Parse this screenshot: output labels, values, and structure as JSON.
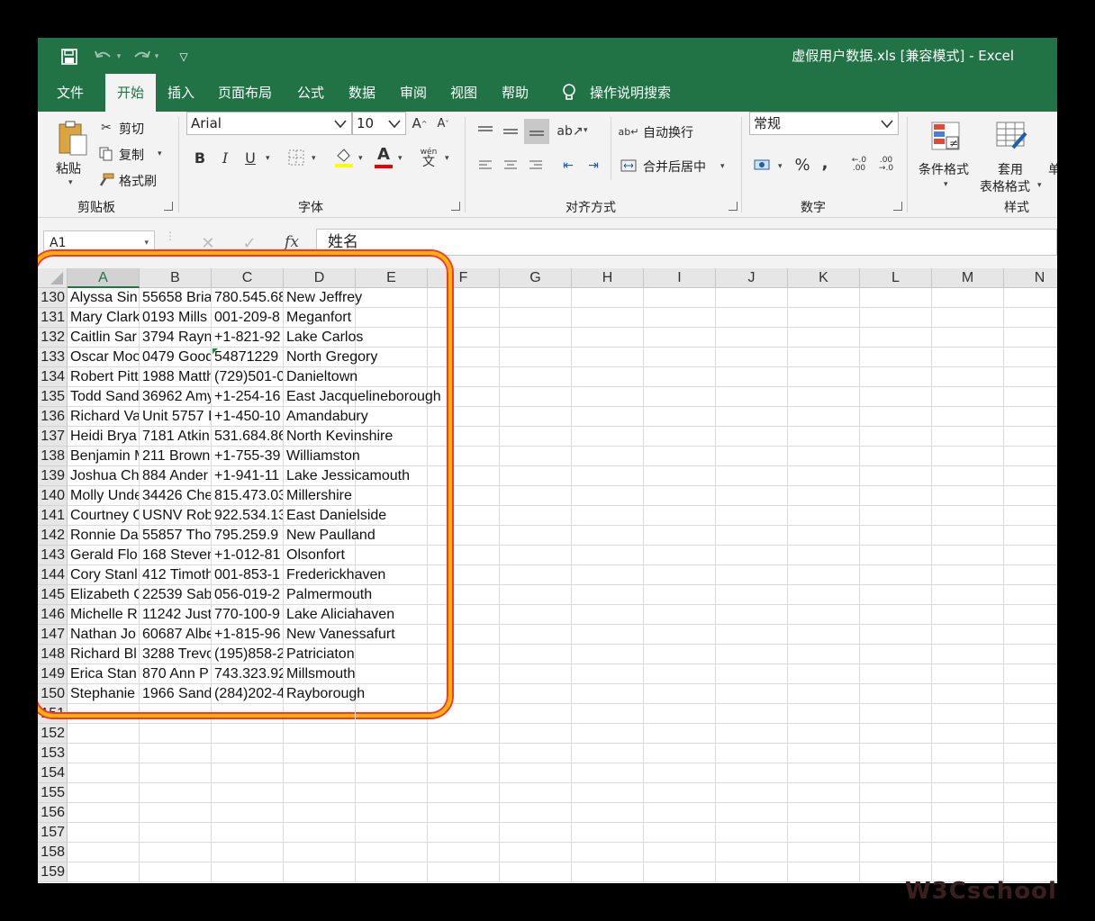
{
  "window": {
    "title": "虚假用户数据.xls  [兼容模式]  -  Excel",
    "colors": {
      "accent": "#217346",
      "ribbon": "#f3f3f3",
      "highlight": "#ffb400"
    }
  },
  "quick_access": {
    "icons": [
      "save-icon",
      "undo-icon",
      "redo-icon",
      "customize-icon"
    ]
  },
  "tabs": [
    {
      "label": "文件"
    },
    {
      "label": "开始",
      "active": true
    },
    {
      "label": "插入"
    },
    {
      "label": "页面布局"
    },
    {
      "label": "公式"
    },
    {
      "label": "数据"
    },
    {
      "label": "审阅"
    },
    {
      "label": "视图"
    },
    {
      "label": "帮助"
    },
    {
      "label": "操作说明搜索"
    }
  ],
  "ribbon": {
    "clipboard": {
      "label": "剪贴板",
      "paste": "粘贴",
      "cut": "剪切",
      "copy": "复制",
      "format_painter": "格式刷"
    },
    "font": {
      "label": "字体",
      "name": "Arial",
      "size": "10",
      "bold": "B",
      "italic": "I",
      "underline": "U",
      "font_color": "A",
      "phonetic": "wén"
    },
    "alignment": {
      "label": "对齐方式",
      "wrap": "自动换行",
      "merge": "合并后居中"
    },
    "number": {
      "label": "数字",
      "format": "常规",
      "percent": "%",
      "comma": ","
    },
    "styles": {
      "label": "样式",
      "conditional": "条件格式",
      "table_fmt_1": "套用",
      "table_fmt_2": "表格格式",
      "cell_styles": "单"
    }
  },
  "formula_bar": {
    "name_box": "A1",
    "fx": "fx",
    "value": "姓名"
  },
  "sheet": {
    "columns": [
      "A",
      "B",
      "C",
      "D",
      "E",
      "F",
      "G",
      "H",
      "I",
      "J",
      "K",
      "L",
      "M",
      "N"
    ],
    "rows": [
      {
        "n": "130",
        "a": "Alyssa Sin",
        "b": "55658 Bria",
        "c": "780.545.68",
        "d": "New Jeffrey"
      },
      {
        "n": "131",
        "a": "Mary Clark",
        "b": "0193 Mills",
        "c": "001-209-8",
        "d": "Meganfort"
      },
      {
        "n": "132",
        "a": "Caitlin Sar",
        "b": "3794 Rayn",
        "c": "+1-821-92",
        "d": "Lake Carlos"
      },
      {
        "n": "133",
        "a": "Oscar Moo",
        "b": "0479 Good",
        "c": "54871229",
        "d": "North Gregory"
      },
      {
        "n": "134",
        "a": "Robert Pitt",
        "b": "1988 Matth",
        "c": "(729)501-0",
        "d": "Danieltown"
      },
      {
        "n": "135",
        "a": "Todd Sand",
        "b": "36962 Amy",
        "c": "+1-254-16",
        "d": "East Jacquelineborough"
      },
      {
        "n": "136",
        "a": "Richard Va",
        "b": "Unit 5757 I",
        "c": "+1-450-10",
        "d": "Amandabury"
      },
      {
        "n": "137",
        "a": "Heidi Brya",
        "b": "7181 Atkin",
        "c": "531.684.86",
        "d": "North Kevinshire"
      },
      {
        "n": "138",
        "a": "Benjamin M",
        "b": "211 Brown",
        "c": "+1-755-39",
        "d": "Williamston"
      },
      {
        "n": "139",
        "a": "Joshua Ch",
        "b": "884 Ander",
        "c": "+1-941-11",
        "d": "Lake Jessicamouth"
      },
      {
        "n": "140",
        "a": "Molly Unde",
        "b": "34426 Che",
        "c": "815.473.03",
        "d": "Millershire"
      },
      {
        "n": "141",
        "a": "Courtney C",
        "b": "USNV Rob",
        "c": "922.534.13",
        "d": "East Danielside"
      },
      {
        "n": "142",
        "a": "Ronnie Da",
        "b": "55857 Tho",
        "c": "795.259.9",
        "d": "New Paulland"
      },
      {
        "n": "143",
        "a": "Gerald Flo",
        "b": "168 Steven",
        "c": "+1-012-81",
        "d": "Olsonfort"
      },
      {
        "n": "144",
        "a": "Cory Stanl",
        "b": "412 Timoth",
        "c": "001-853-1",
        "d": "Frederickhaven"
      },
      {
        "n": "145",
        "a": "Elizabeth C",
        "b": "22539 Sab",
        "c": "056-019-2",
        "d": "Palmermouth"
      },
      {
        "n": "146",
        "a": "Michelle R",
        "b": "11242 Just",
        "c": "770-100-9",
        "d": "Lake Aliciahaven"
      },
      {
        "n": "147",
        "a": "Nathan Jo",
        "b": "60687 Albe",
        "c": "+1-815-96",
        "d": "New Vanessafurt"
      },
      {
        "n": "148",
        "a": "Richard Bl",
        "b": "3288 Trevo",
        "c": "(195)858-2",
        "d": "Patriciaton"
      },
      {
        "n": "149",
        "a": "Erica Stan",
        "b": "870 Ann P",
        "c": "743.323.92",
        "d": "Millsmouth"
      },
      {
        "n": "150",
        "a": "Stephanie",
        "b": "1966 Sand",
        "c": "(284)202-4",
        "d": "Rayborough"
      },
      {
        "n": "151",
        "a": "",
        "b": "",
        "c": "",
        "d": ""
      },
      {
        "n": "152",
        "a": "",
        "b": "",
        "c": "",
        "d": ""
      },
      {
        "n": "153",
        "a": "",
        "b": "",
        "c": "",
        "d": ""
      },
      {
        "n": "154",
        "a": "",
        "b": "",
        "c": "",
        "d": ""
      },
      {
        "n": "155",
        "a": "",
        "b": "",
        "c": "",
        "d": ""
      },
      {
        "n": "156",
        "a": "",
        "b": "",
        "c": "",
        "d": ""
      },
      {
        "n": "157",
        "a": "",
        "b": "",
        "c": "",
        "d": ""
      },
      {
        "n": "158",
        "a": "",
        "b": "",
        "c": "",
        "d": ""
      },
      {
        "n": "159",
        "a": "",
        "b": "",
        "c": "",
        "d": ""
      }
    ]
  },
  "watermark": "W3Cschool"
}
